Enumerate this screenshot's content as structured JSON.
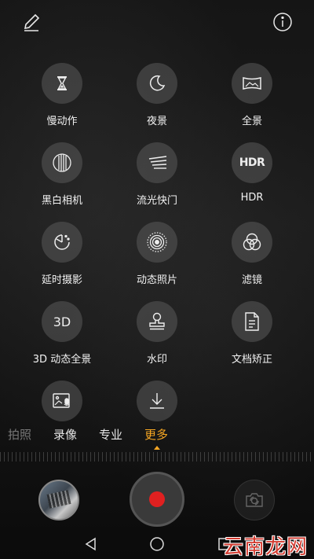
{
  "colors": {
    "accent": "#f5a623",
    "record_red": "#e02020",
    "icon_circle": "#5a5a5a",
    "watermark_red": "#d33a2f"
  },
  "topbar": {
    "left_icon": "pencil-icon",
    "right_icon": "info-icon"
  },
  "modes": [
    {
      "label": "慢动作",
      "icon": "hourglass-icon"
    },
    {
      "label": "夜景",
      "icon": "moon-icon"
    },
    {
      "label": "全景",
      "icon": "panorama-icon"
    },
    {
      "label": "黑白相机",
      "icon": "monochrome-lens-icon"
    },
    {
      "label": "流光快门",
      "icon": "light-streak-icon"
    },
    {
      "label": "HDR",
      "icon": "hdr-icon",
      "icon_text": "HDR"
    },
    {
      "label": "延时摄影",
      "icon": "timelapse-icon"
    },
    {
      "label": "动态照片",
      "icon": "moving-picture-icon"
    },
    {
      "label": "滤镜",
      "icon": "filter-icon"
    },
    {
      "label": "3D 动态全景",
      "icon": "3d-icon",
      "icon_text": "3D"
    },
    {
      "label": "水印",
      "icon": "stamp-icon"
    },
    {
      "label": "文档矫正",
      "icon": "document-icon"
    },
    {
      "label": "",
      "icon": "image-audio-icon"
    },
    {
      "label": "",
      "icon": "download-icon"
    }
  ],
  "tabs": [
    {
      "label": "拍照",
      "state": "dim"
    },
    {
      "label": "录像",
      "state": "normal"
    },
    {
      "label": "专业",
      "state": "normal"
    },
    {
      "label": "更多",
      "state": "active"
    }
  ],
  "bottom": {
    "thumbnail": "gallery-thumbnail",
    "shutter": "record-shutter-button",
    "switch": "switch-camera-icon"
  },
  "navbar": {
    "back": "back-triangle-icon",
    "home": "home-circle-icon",
    "recents": "recents-square-icon"
  },
  "watermark": "云南龙网"
}
